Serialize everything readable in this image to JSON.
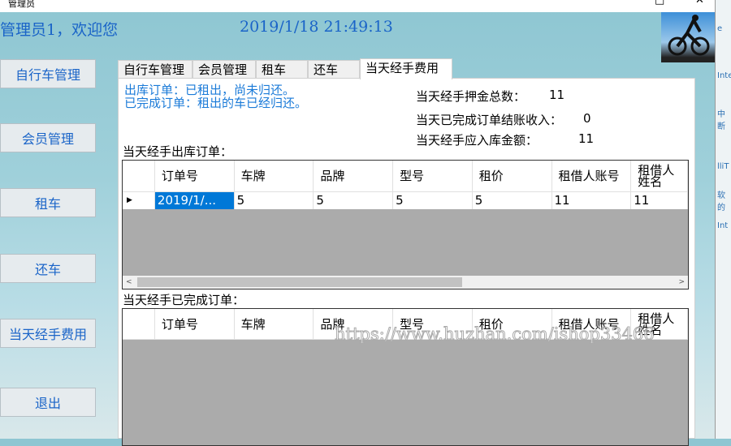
{
  "window": {
    "title": "管理员",
    "maximize_icon": "□",
    "close_icon": "✕"
  },
  "header": {
    "welcome": "管理员1，欢迎您",
    "datetime": "2019/1/18  21:49:13"
  },
  "nav": [
    "自行车管理",
    "会员管理",
    "租车",
    "还车",
    "当天经手费用",
    "退出"
  ],
  "tabs": [
    "自行车管理",
    "会员管理",
    "租车",
    "还车",
    "当天经手费用"
  ],
  "notes": [
    "出库订单：已租出，尚未归还。",
    "已完成订单：租出的车已经归还。"
  ],
  "stats": [
    {
      "label": "当天经手押金总数：",
      "value": "11"
    },
    {
      "label": "当天已完成订单结账收入：",
      "value": "0"
    },
    {
      "label": "当天经手应入库金额：",
      "value": "11"
    }
  ],
  "grid1": {
    "title": "当天经手出库订单：",
    "columns": [
      "订单号",
      "车牌",
      "品牌",
      "型号",
      "租价",
      "租借人账号",
      "租借人姓名"
    ],
    "rows": [
      [
        "2019/1/...",
        "5",
        "5",
        "5",
        "5",
        "11",
        "11"
      ]
    ]
  },
  "grid2": {
    "title": "当天经手已完成订单：",
    "columns": [
      "订单号",
      "车牌",
      "品牌",
      "型号",
      "租价",
      "租借人账号",
      "租借人姓名"
    ]
  },
  "watermark": "https://www.huzhan.com/ishop33466",
  "side_window": [
    "e",
    "Inte",
    "中断",
    "lliT",
    "软的",
    "Int"
  ]
}
